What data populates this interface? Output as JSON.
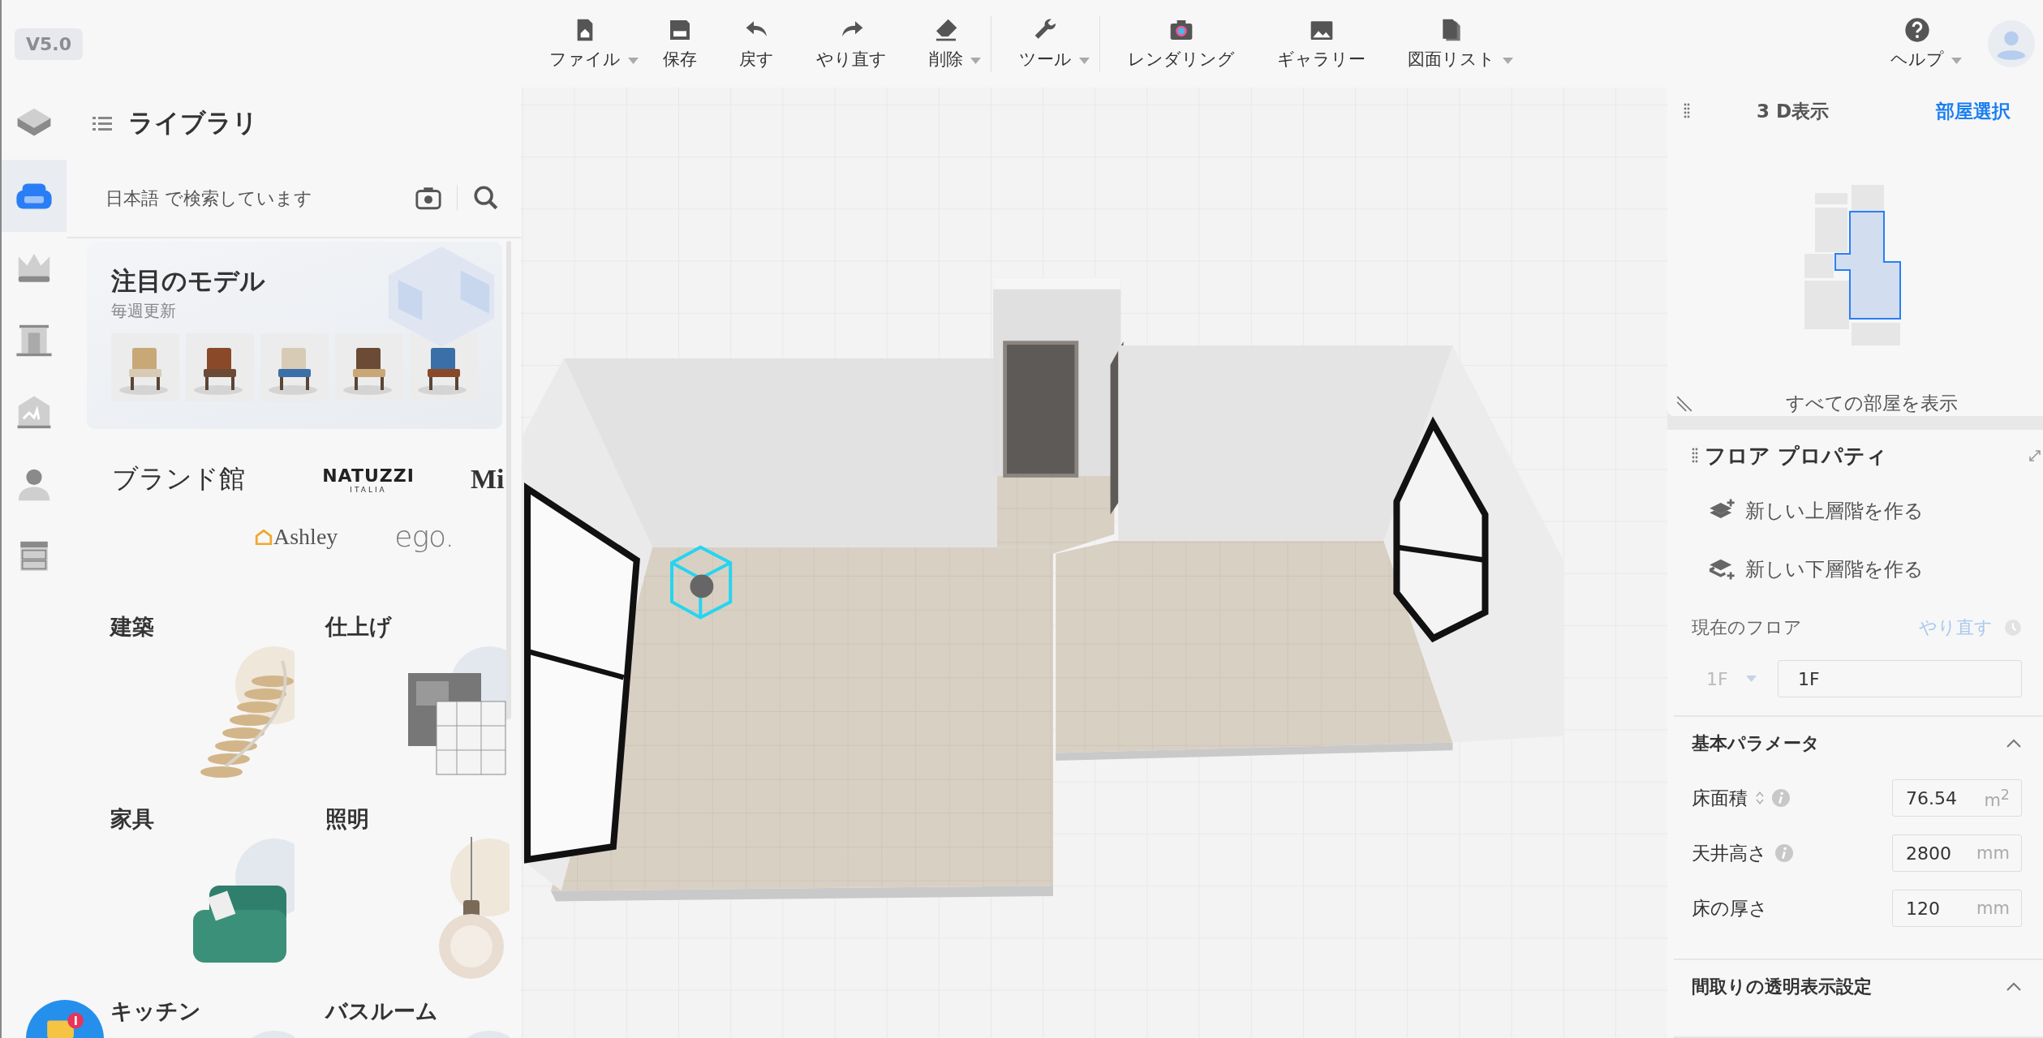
{
  "version": "V5.0",
  "toolbar": {
    "groups": [
      {
        "items": [
          {
            "kind": "file",
            "label": "ファイル",
            "dropdown": true
          },
          {
            "kind": "save",
            "label": "保存",
            "dropdown": false
          },
          {
            "kind": "undo",
            "label": "戻す",
            "dropdown": false
          },
          {
            "kind": "redo",
            "label": "やり直す",
            "dropdown": false
          },
          {
            "kind": "erase",
            "label": "削除",
            "dropdown": true
          }
        ]
      },
      {
        "items": [
          {
            "kind": "tool",
            "label": "ツール",
            "dropdown": true
          }
        ]
      },
      {
        "items": [
          {
            "kind": "render",
            "label": "レンダリング",
            "dropdown": false
          },
          {
            "kind": "gallery",
            "label": "ギャラリー",
            "dropdown": false
          },
          {
            "kind": "drawings",
            "label": "図面リスト",
            "dropdown": true
          }
        ]
      }
    ]
  },
  "help": {
    "label": "ヘルプ",
    "dropdown": true
  },
  "rail": [
    {
      "kind": "cube",
      "selected": false
    },
    {
      "kind": "sofa",
      "selected": true
    },
    {
      "kind": "crown",
      "selected": false
    },
    {
      "kind": "door",
      "selected": false
    },
    {
      "kind": "house",
      "selected": false
    },
    {
      "kind": "person",
      "selected": false
    },
    {
      "kind": "cabinet",
      "selected": false
    }
  ],
  "library": {
    "title": "ライブラリ",
    "search": {
      "placeholder": "日本語 で検索しています"
    },
    "featured": {
      "title": "注目のモデル",
      "subtitle": "毎週更新"
    },
    "brands": {
      "title": "ブランド館",
      "logos": [
        {
          "kind": "caps",
          "name": "NATUZZI",
          "sub": "ITALIA"
        },
        {
          "kind": "serif",
          "name": "Mi"
        },
        {
          "kind": "house",
          "name": "Ashley"
        },
        {
          "kind": "thin",
          "name": "ego."
        }
      ]
    },
    "categories": [
      {
        "label": "建築"
      },
      {
        "label": "仕上げ"
      },
      {
        "label": "家具"
      },
      {
        "label": "照明"
      },
      {
        "label": "キッチン"
      },
      {
        "label": "バスルーム"
      }
    ]
  },
  "view_panel": {
    "title": "3 D表示",
    "link": "部屋選択",
    "footer": "すべての部屋を表示"
  },
  "floor_panel": {
    "title": "フロア プロパティ",
    "actions": [
      {
        "kind": "add_above",
        "label": "新しい上層階を作る"
      },
      {
        "kind": "add_below",
        "label": "新しい下層階を作る"
      }
    ],
    "current_floor": {
      "label": "現在のフロア",
      "redo": {
        "label": "やり直す",
        "disabled": true
      },
      "level_select": {
        "value": "1F",
        "disabled": true
      },
      "name": "1F"
    },
    "sections": [
      {
        "title": "基本パラメータ",
        "expanded": true,
        "rows": [
          {
            "label": "床面積",
            "sortable": true,
            "info": true,
            "value": "76.54",
            "unit": "m$^{2}$"
          },
          {
            "label": "天井高さ",
            "sortable": false,
            "info": true,
            "value": "2800",
            "unit": "mm"
          },
          {
            "label": "床の厚さ",
            "sortable": false,
            "info": false,
            "value": "120",
            "unit": "mm"
          }
        ]
      },
      {
        "title": "間取りの透明表示設定",
        "expanded": true
      }
    ]
  }
}
